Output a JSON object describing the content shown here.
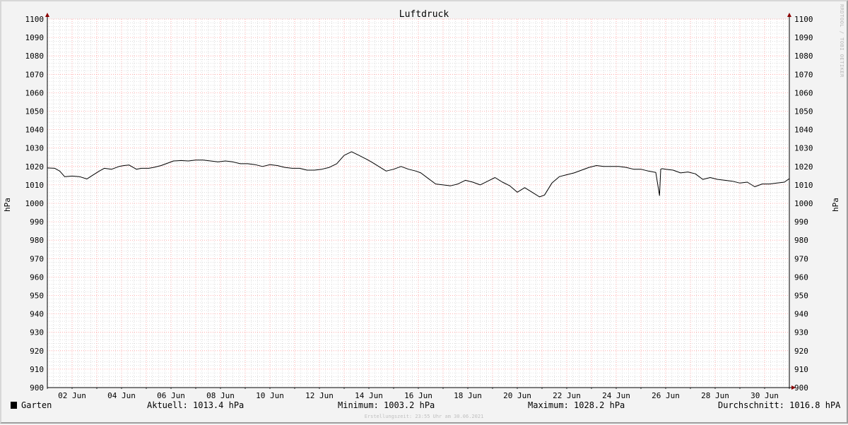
{
  "chart_data": {
    "type": "line",
    "title": "Luftdruck",
    "ylabel": "hPa",
    "ylabel_right": "hPa",
    "ylim": [
      900,
      1100
    ],
    "y_ticks": [
      "900",
      "910",
      "920",
      "930",
      "940",
      "950",
      "960",
      "970",
      "980",
      "990",
      "1000",
      "1010",
      "1020",
      "1030",
      "1040",
      "1050",
      "1060",
      "1070",
      "1080",
      "1090",
      "1100"
    ],
    "x_ticks": [
      "02 Jun",
      "04 Jun",
      "06 Jun",
      "08 Jun",
      "10 Jun",
      "12 Jun",
      "14 Jun",
      "16 Jun",
      "18 Jun",
      "20 Jun",
      "22 Jun",
      "24 Jun",
      "26 Jun",
      "28 Jun",
      "30 Jun"
    ],
    "x_unit": "day of June 2021",
    "xlim": [
      1.0,
      31.0
    ],
    "grid": true,
    "series": [
      {
        "name": "Garten",
        "color": "#000000",
        "x": [
          1.0,
          1.3,
          1.5,
          1.7,
          2.0,
          2.3,
          2.6,
          2.8,
          3.1,
          3.3,
          3.6,
          3.9,
          4.1,
          4.3,
          4.6,
          4.8,
          5.1,
          5.3,
          5.6,
          5.9,
          6.1,
          6.4,
          6.7,
          7.0,
          7.3,
          7.6,
          7.9,
          8.2,
          8.5,
          8.8,
          9.1,
          9.4,
          9.7,
          10.0,
          10.3,
          10.6,
          10.9,
          11.2,
          11.5,
          11.8,
          12.1,
          12.4,
          12.7,
          13.0,
          13.3,
          13.6,
          13.9,
          14.1,
          14.4,
          14.7,
          15.0,
          15.3,
          15.6,
          15.9,
          16.1,
          16.4,
          16.7,
          17.0,
          17.3,
          17.6,
          17.9,
          18.2,
          18.5,
          18.8,
          19.1,
          19.4,
          19.7,
          20.0,
          20.3,
          20.6,
          20.9,
          21.1,
          21.4,
          21.7,
          22.0,
          22.3,
          22.6,
          22.9,
          23.2,
          23.5,
          23.8,
          24.1,
          24.4,
          24.7,
          25.0,
          25.3,
          25.6,
          25.75,
          25.8,
          25.85,
          26.0,
          26.3,
          26.6,
          26.9,
          27.2,
          27.5,
          27.8,
          28.1,
          28.4,
          28.7,
          29.0,
          29.3,
          29.6,
          29.9,
          30.2,
          30.5,
          30.8,
          31.0
        ],
        "values": [
          1019.2,
          1019.0,
          1017.5,
          1014.5,
          1014.8,
          1014.5,
          1013.2,
          1015.0,
          1017.5,
          1019.0,
          1018.5,
          1020.0,
          1020.5,
          1020.8,
          1018.5,
          1019.0,
          1019.0,
          1019.5,
          1020.5,
          1022.0,
          1023.0,
          1023.2,
          1023.0,
          1023.5,
          1023.5,
          1023.0,
          1022.5,
          1023.0,
          1022.5,
          1021.5,
          1021.5,
          1021.0,
          1020.0,
          1021.0,
          1020.5,
          1019.5,
          1019.0,
          1019.0,
          1018.0,
          1018.0,
          1018.5,
          1019.5,
          1021.5,
          1026.0,
          1028.0,
          1026.0,
          1024.0,
          1022.5,
          1020.0,
          1017.5,
          1018.5,
          1020.0,
          1018.5,
          1017.5,
          1016.5,
          1013.5,
          1010.5,
          1010.0,
          1009.5,
          1010.5,
          1012.5,
          1011.5,
          1010.0,
          1012.0,
          1014.0,
          1011.5,
          1009.5,
          1006.0,
          1008.5,
          1006.0,
          1003.5,
          1004.5,
          1011.0,
          1014.5,
          1015.5,
          1016.5,
          1018.0,
          1019.5,
          1020.5,
          1020.0,
          1020.0,
          1020.0,
          1019.5,
          1018.5,
          1018.5,
          1017.5,
          1016.8,
          1004.2,
          1018.5,
          1018.8,
          1018.5,
          1018.0,
          1016.5,
          1017.0,
          1016.0,
          1013.0,
          1014.0,
          1013.0,
          1012.5,
          1012.0,
          1011.0,
          1011.5,
          1009.0,
          1010.5,
          1010.5,
          1011.0,
          1011.5,
          1013.4
        ]
      }
    ],
    "legend_placement": "bottom-left"
  },
  "legend": {
    "name": "Garten",
    "swatch_color": "#000000",
    "aktuell": "Aktuell: 1013.4 hPa",
    "minimum": "Minimum: 1003.2 hPa",
    "maximum": "Maximum: 1028.2 hPa",
    "durchschnitt": "Durchschnitt: 1016.8 hPA"
  },
  "footer": "Erstellungszeit: 23:55 Uhr am 30.06.2021",
  "watermark": "RRDTOOL / TOBI OETIKER",
  "colors": {
    "background": "#f3f3f3",
    "plot_area": "#ffffff",
    "major_grid": "#ff9999",
    "minor_grid": "#c8c8c8",
    "axis_arrow": "#8b0000",
    "line": "#000000"
  }
}
